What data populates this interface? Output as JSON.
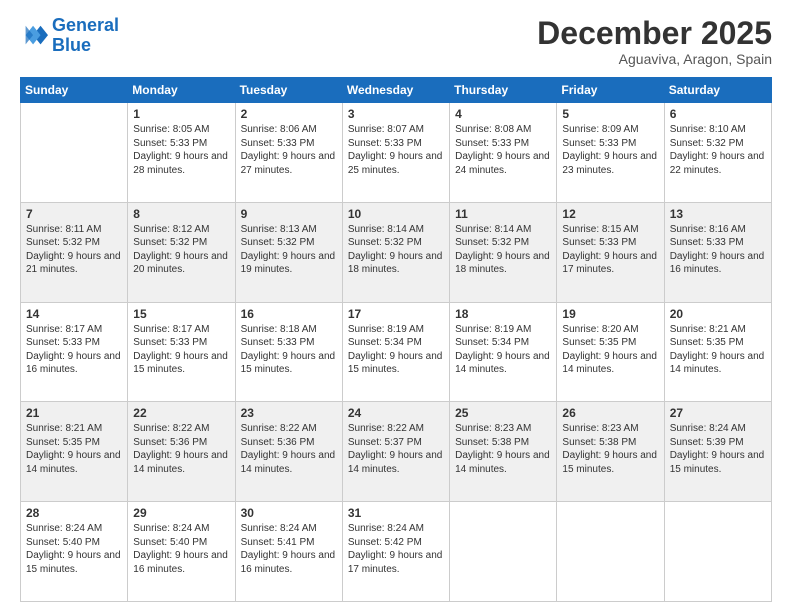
{
  "logo": {
    "line1": "General",
    "line2": "Blue"
  },
  "title": "December 2025",
  "location": "Aguaviva, Aragon, Spain",
  "weekdays": [
    "Sunday",
    "Monday",
    "Tuesday",
    "Wednesday",
    "Thursday",
    "Friday",
    "Saturday"
  ],
  "weeks": [
    [
      {
        "day": "",
        "sunrise": "",
        "sunset": "",
        "daylight": ""
      },
      {
        "day": "1",
        "sunrise": "Sunrise: 8:05 AM",
        "sunset": "Sunset: 5:33 PM",
        "daylight": "Daylight: 9 hours and 28 minutes."
      },
      {
        "day": "2",
        "sunrise": "Sunrise: 8:06 AM",
        "sunset": "Sunset: 5:33 PM",
        "daylight": "Daylight: 9 hours and 27 minutes."
      },
      {
        "day": "3",
        "sunrise": "Sunrise: 8:07 AM",
        "sunset": "Sunset: 5:33 PM",
        "daylight": "Daylight: 9 hours and 25 minutes."
      },
      {
        "day": "4",
        "sunrise": "Sunrise: 8:08 AM",
        "sunset": "Sunset: 5:33 PM",
        "daylight": "Daylight: 9 hours and 24 minutes."
      },
      {
        "day": "5",
        "sunrise": "Sunrise: 8:09 AM",
        "sunset": "Sunset: 5:33 PM",
        "daylight": "Daylight: 9 hours and 23 minutes."
      },
      {
        "day": "6",
        "sunrise": "Sunrise: 8:10 AM",
        "sunset": "Sunset: 5:32 PM",
        "daylight": "Daylight: 9 hours and 22 minutes."
      }
    ],
    [
      {
        "day": "7",
        "sunrise": "Sunrise: 8:11 AM",
        "sunset": "Sunset: 5:32 PM",
        "daylight": "Daylight: 9 hours and 21 minutes."
      },
      {
        "day": "8",
        "sunrise": "Sunrise: 8:12 AM",
        "sunset": "Sunset: 5:32 PM",
        "daylight": "Daylight: 9 hours and 20 minutes."
      },
      {
        "day": "9",
        "sunrise": "Sunrise: 8:13 AM",
        "sunset": "Sunset: 5:32 PM",
        "daylight": "Daylight: 9 hours and 19 minutes."
      },
      {
        "day": "10",
        "sunrise": "Sunrise: 8:14 AM",
        "sunset": "Sunset: 5:32 PM",
        "daylight": "Daylight: 9 hours and 18 minutes."
      },
      {
        "day": "11",
        "sunrise": "Sunrise: 8:14 AM",
        "sunset": "Sunset: 5:32 PM",
        "daylight": "Daylight: 9 hours and 18 minutes."
      },
      {
        "day": "12",
        "sunrise": "Sunrise: 8:15 AM",
        "sunset": "Sunset: 5:33 PM",
        "daylight": "Daylight: 9 hours and 17 minutes."
      },
      {
        "day": "13",
        "sunrise": "Sunrise: 8:16 AM",
        "sunset": "Sunset: 5:33 PM",
        "daylight": "Daylight: 9 hours and 16 minutes."
      }
    ],
    [
      {
        "day": "14",
        "sunrise": "Sunrise: 8:17 AM",
        "sunset": "Sunset: 5:33 PM",
        "daylight": "Daylight: 9 hours and 16 minutes."
      },
      {
        "day": "15",
        "sunrise": "Sunrise: 8:17 AM",
        "sunset": "Sunset: 5:33 PM",
        "daylight": "Daylight: 9 hours and 15 minutes."
      },
      {
        "day": "16",
        "sunrise": "Sunrise: 8:18 AM",
        "sunset": "Sunset: 5:33 PM",
        "daylight": "Daylight: 9 hours and 15 minutes."
      },
      {
        "day": "17",
        "sunrise": "Sunrise: 8:19 AM",
        "sunset": "Sunset: 5:34 PM",
        "daylight": "Daylight: 9 hours and 15 minutes."
      },
      {
        "day": "18",
        "sunrise": "Sunrise: 8:19 AM",
        "sunset": "Sunset: 5:34 PM",
        "daylight": "Daylight: 9 hours and 14 minutes."
      },
      {
        "day": "19",
        "sunrise": "Sunrise: 8:20 AM",
        "sunset": "Sunset: 5:35 PM",
        "daylight": "Daylight: 9 hours and 14 minutes."
      },
      {
        "day": "20",
        "sunrise": "Sunrise: 8:21 AM",
        "sunset": "Sunset: 5:35 PM",
        "daylight": "Daylight: 9 hours and 14 minutes."
      }
    ],
    [
      {
        "day": "21",
        "sunrise": "Sunrise: 8:21 AM",
        "sunset": "Sunset: 5:35 PM",
        "daylight": "Daylight: 9 hours and 14 minutes."
      },
      {
        "day": "22",
        "sunrise": "Sunrise: 8:22 AM",
        "sunset": "Sunset: 5:36 PM",
        "daylight": "Daylight: 9 hours and 14 minutes."
      },
      {
        "day": "23",
        "sunrise": "Sunrise: 8:22 AM",
        "sunset": "Sunset: 5:36 PM",
        "daylight": "Daylight: 9 hours and 14 minutes."
      },
      {
        "day": "24",
        "sunrise": "Sunrise: 8:22 AM",
        "sunset": "Sunset: 5:37 PM",
        "daylight": "Daylight: 9 hours and 14 minutes."
      },
      {
        "day": "25",
        "sunrise": "Sunrise: 8:23 AM",
        "sunset": "Sunset: 5:38 PM",
        "daylight": "Daylight: 9 hours and 14 minutes."
      },
      {
        "day": "26",
        "sunrise": "Sunrise: 8:23 AM",
        "sunset": "Sunset: 5:38 PM",
        "daylight": "Daylight: 9 hours and 15 minutes."
      },
      {
        "day": "27",
        "sunrise": "Sunrise: 8:24 AM",
        "sunset": "Sunset: 5:39 PM",
        "daylight": "Daylight: 9 hours and 15 minutes."
      }
    ],
    [
      {
        "day": "28",
        "sunrise": "Sunrise: 8:24 AM",
        "sunset": "Sunset: 5:40 PM",
        "daylight": "Daylight: 9 hours and 15 minutes."
      },
      {
        "day": "29",
        "sunrise": "Sunrise: 8:24 AM",
        "sunset": "Sunset: 5:40 PM",
        "daylight": "Daylight: 9 hours and 16 minutes."
      },
      {
        "day": "30",
        "sunrise": "Sunrise: 8:24 AM",
        "sunset": "Sunset: 5:41 PM",
        "daylight": "Daylight: 9 hours and 16 minutes."
      },
      {
        "day": "31",
        "sunrise": "Sunrise: 8:24 AM",
        "sunset": "Sunset: 5:42 PM",
        "daylight": "Daylight: 9 hours and 17 minutes."
      },
      {
        "day": "",
        "sunrise": "",
        "sunset": "",
        "daylight": ""
      },
      {
        "day": "",
        "sunrise": "",
        "sunset": "",
        "daylight": ""
      },
      {
        "day": "",
        "sunrise": "",
        "sunset": "",
        "daylight": ""
      }
    ]
  ]
}
